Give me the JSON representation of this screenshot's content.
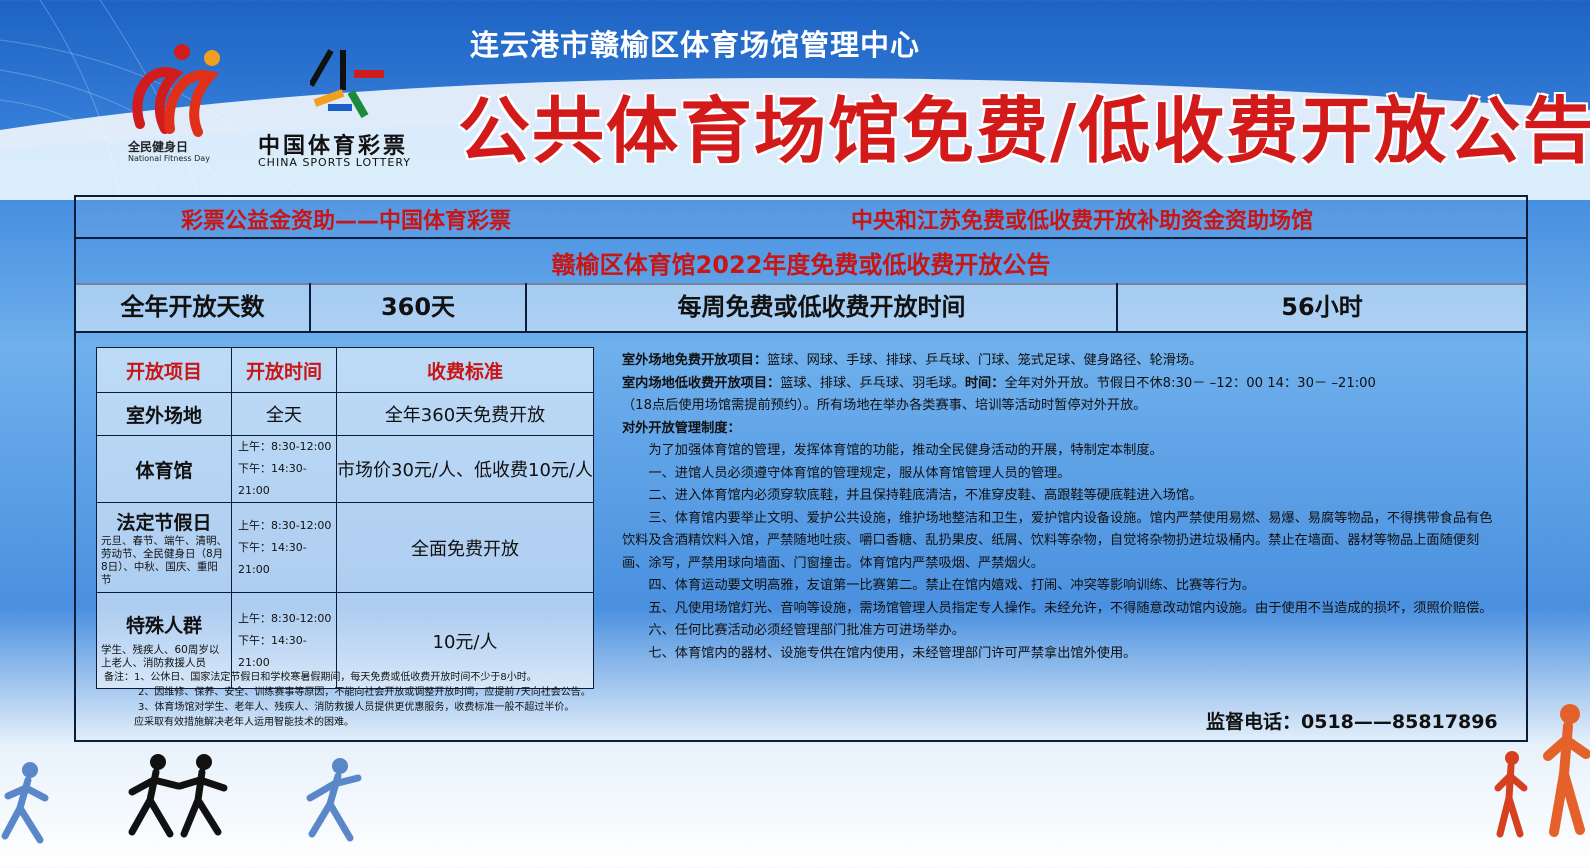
{
  "header": {
    "org": "连云港市赣榆区体育场馆管理中心",
    "title": "公共体育场馆免费/低收费开放公告",
    "logo_fitness_cn": "全民健身日",
    "logo_fitness_en": "National Fitness Day",
    "logo_lottery_cn": "中国体育彩票",
    "logo_lottery_en": "CHINA SPORTS LOTTERY"
  },
  "board": {
    "sponsor_left": "彩票公益金资助——中国体育彩票",
    "sponsor_right": "中央和江苏免费或低收费开放补助资金资助场馆",
    "subtitle": "赣榆区体育馆2022年度免费或低收费开放公告",
    "stats": [
      "全年开放天数",
      "360天",
      "每周免费或低收费开放时间",
      "56小时"
    ]
  },
  "fee_table": {
    "headers": [
      "开放项目",
      "开放时间",
      "收费标准"
    ],
    "rows": [
      {
        "name": "室外场地",
        "time": "全天",
        "fee": "全年360天免费开放"
      },
      {
        "name": "体育馆",
        "am": "上午：8:30-12:00",
        "pm": "下午：14:30-21:00",
        "fee": "市场价30元/人、低收费10元/人"
      },
      {
        "name": "法定节假日",
        "desc": "元旦、春节、端午、清明、劳动节、全民健身日（8月8日）、中秋、国庆、重阳节",
        "am": "上午：8:30-12:00",
        "pm": "下午：14:30-21:00",
        "fee": "全面免费开放"
      },
      {
        "name": "特殊人群",
        "desc": "学生、残疾人、60周岁以上老人、消防救援人员",
        "am": "上午：8:30-12:00",
        "pm": "下午：14:30-21:00",
        "fee": "10元/人"
      }
    ]
  },
  "notes": [
    "备注：1、公休日、国家法定节假日和学校寒暑假期间，每天免费或低收费开放时间不少于8小时。",
    "2、因维修、保养、安全、训练赛事等原因，不能向社会开放或调整开放时间，应提前7天向社会公告。",
    "3、体育场馆对学生、老年人、残疾人、消防救援人员提供更优惠服务，收费标准一般不超过半价。",
    "应采取有效措施解决老年人运用智能技术的困难。"
  ],
  "rules": {
    "outdoor_label": "室外场地免费开放项目：",
    "outdoor_text": "篮球、网球、手球、排球、乒乓球、门球、笼式足球、健身路径、轮滑场。",
    "indoor_label": "室内场地低收费开放项目：",
    "indoor_text": "篮球、排球、乒乓球、羽毛球。",
    "time_label": "时间：",
    "time_text": "全年对外开放。节假日不休8:30－ –12：00 14：30－ –21:00",
    "time_text2": "（18点后使用场馆需提前预约）。所有场地在举办各类赛事、培训等活动时暂停对外开放。",
    "mgmt_label": "对外开放管理制度：",
    "items": [
      "为了加强体育馆的管理，发挥体育馆的功能，推动全民健身活动的开展，特制定本制度。",
      "一、进馆人员必须遵守体育馆的管理规定，服从体育馆管理人员的管理。",
      "二、进入体育馆内必须穿软底鞋，并且保持鞋底清洁，不准穿皮鞋、高跟鞋等硬底鞋进入场馆。",
      "三、体育馆内要举止文明、爱护公共设施，维护场地整洁和卫生，爱护馆内设备设施。馆内严禁使用易燃、易爆、易腐等物品，不得携带食品有色饮料及含酒精饮料入馆，严禁随地吐痰、嚼口香糖、乱扔果皮、纸屑、饮料等杂物，自觉将杂物扔进垃圾桶内。禁止在墙面、器材等物品上面随便刻画、涂写，严禁用球向墙面、门窗撞击。体育馆内严禁吸烟、严禁烟火。",
      "四、体育运动要文明高雅，友谊第一比赛第二。禁止在馆内嬉戏、打闹、冲突等影响训练、比赛等行为。",
      "五、凡使用场馆灯光、音响等设施，需场馆管理人员指定专人操作。未经允许，不得随意改动馆内设施。由于使用不当造成的损坏，须照价赔偿。",
      "六、任何比赛活动必须经管理部门批准方可进场举办。",
      "七、体育馆内的器材、设施专供在馆内使用，未经管理部门许可严禁拿出馆外使用。"
    ]
  },
  "phone": "监督电话：0518——85817896",
  "colors": {
    "accent_red": "#c81515",
    "border": "#0b1d3a"
  }
}
